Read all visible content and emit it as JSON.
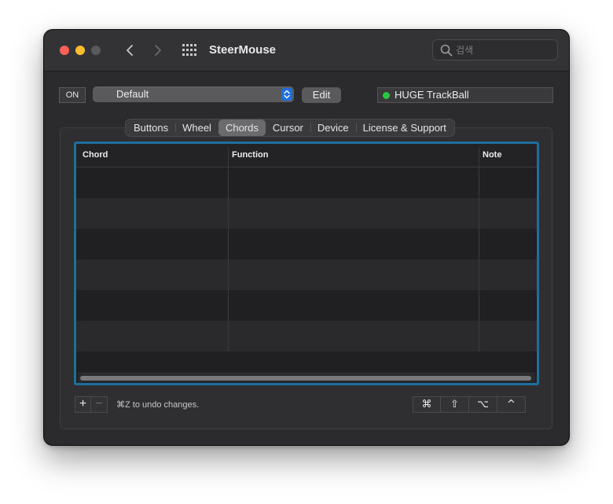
{
  "window": {
    "title": "SteerMouse"
  },
  "search": {
    "placeholder": "검색"
  },
  "toolbar": {
    "on_label": "ON",
    "preset_value": "Default",
    "edit_label": "Edit"
  },
  "device": {
    "name": "HUGE TrackBall",
    "status_color": "#27c93f"
  },
  "tabs": [
    {
      "label": "Buttons",
      "active": false
    },
    {
      "label": "Wheel",
      "active": false
    },
    {
      "label": "Chords",
      "active": true
    },
    {
      "label": "Cursor",
      "active": false
    },
    {
      "label": "Device",
      "active": false
    },
    {
      "label": "License & Support",
      "active": false
    }
  ],
  "table": {
    "columns": [
      "Chord",
      "Function",
      "Note"
    ],
    "rows": []
  },
  "footer": {
    "add_label": "+",
    "remove_label": "−",
    "undo_hint": "⌘Z to undo changes.",
    "modifier_keys": [
      "⌘",
      "⇧",
      "⌥",
      "^"
    ]
  },
  "colors": {
    "accent": "#1e6e9e",
    "stepper": "#1f6fe0",
    "close": "#fe5f57",
    "minimize": "#febc2e"
  },
  "icons": {
    "back": "chevron-left-icon",
    "forward": "chevron-right-icon",
    "grid": "grid-icon",
    "search": "search-icon",
    "stepper": "up-down-chevron-icon"
  }
}
